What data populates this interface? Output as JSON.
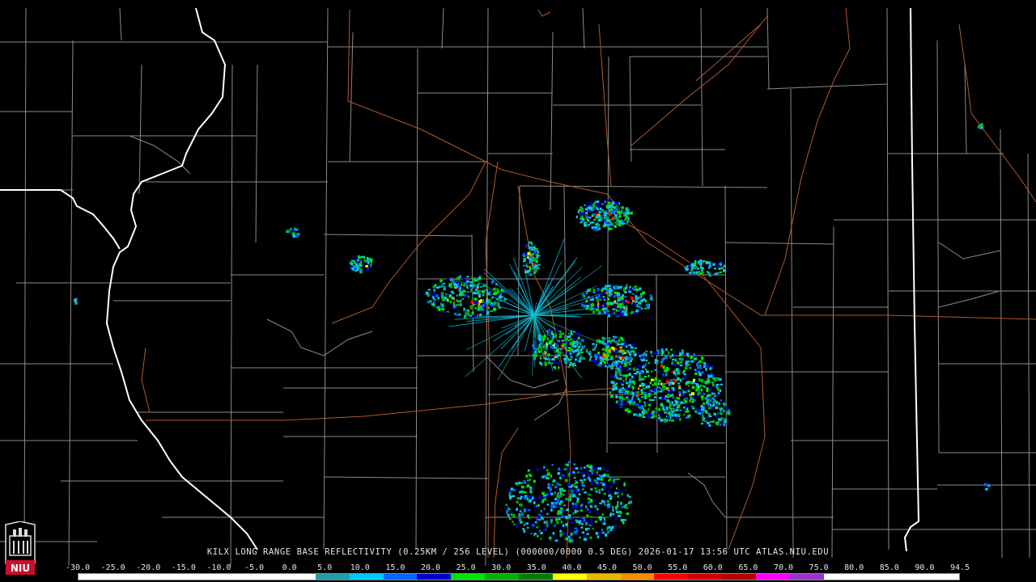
{
  "product": {
    "caption": "KILX LONG RANGE BASE REFLECTIVITY (0.25KM / 256 LEVEL) (000000/0000 0.5 DEG) 2026-01-17 13:56 UTC  ATLAS.NIU.EDU"
  },
  "logo": {
    "text": "NIU",
    "color": "#c8102e"
  },
  "scale": {
    "labels": [
      "-30.0",
      "-25.0",
      "-20.0",
      "-15.0",
      "-10.0",
      "-5.0",
      "0.0",
      "5.0",
      "10.0",
      "15.0",
      "20.0",
      "25.0",
      "30.0",
      "35.0",
      "40.0",
      "45.0",
      "50.0",
      "55.0",
      "60.0",
      "65.0",
      "70.0",
      "75.0",
      "80.0",
      "85.0",
      "90.0",
      "94.5"
    ],
    "colors": [
      "#ffffff",
      "#ffffff",
      "#ffffff",
      "#ffffff",
      "#ffffff",
      "#ffffff",
      "#ffffff",
      "#1f9fa6",
      "#00c8ff",
      "#0066ff",
      "#0000c8",
      "#00e600",
      "#00b000",
      "#008000",
      "#ffff00",
      "#e6b800",
      "#ff8c00",
      "#ff0000",
      "#d00000",
      "#b00000",
      "#ff00ff",
      "#9933cc",
      "#ffffff",
      "#ffffff",
      "#ffffff",
      "#ffffff"
    ]
  },
  "map_colors": {
    "county_line": "#8a8a8a",
    "state_line": "#ffffff",
    "highway": "#b05a2c",
    "background": "#000000"
  }
}
